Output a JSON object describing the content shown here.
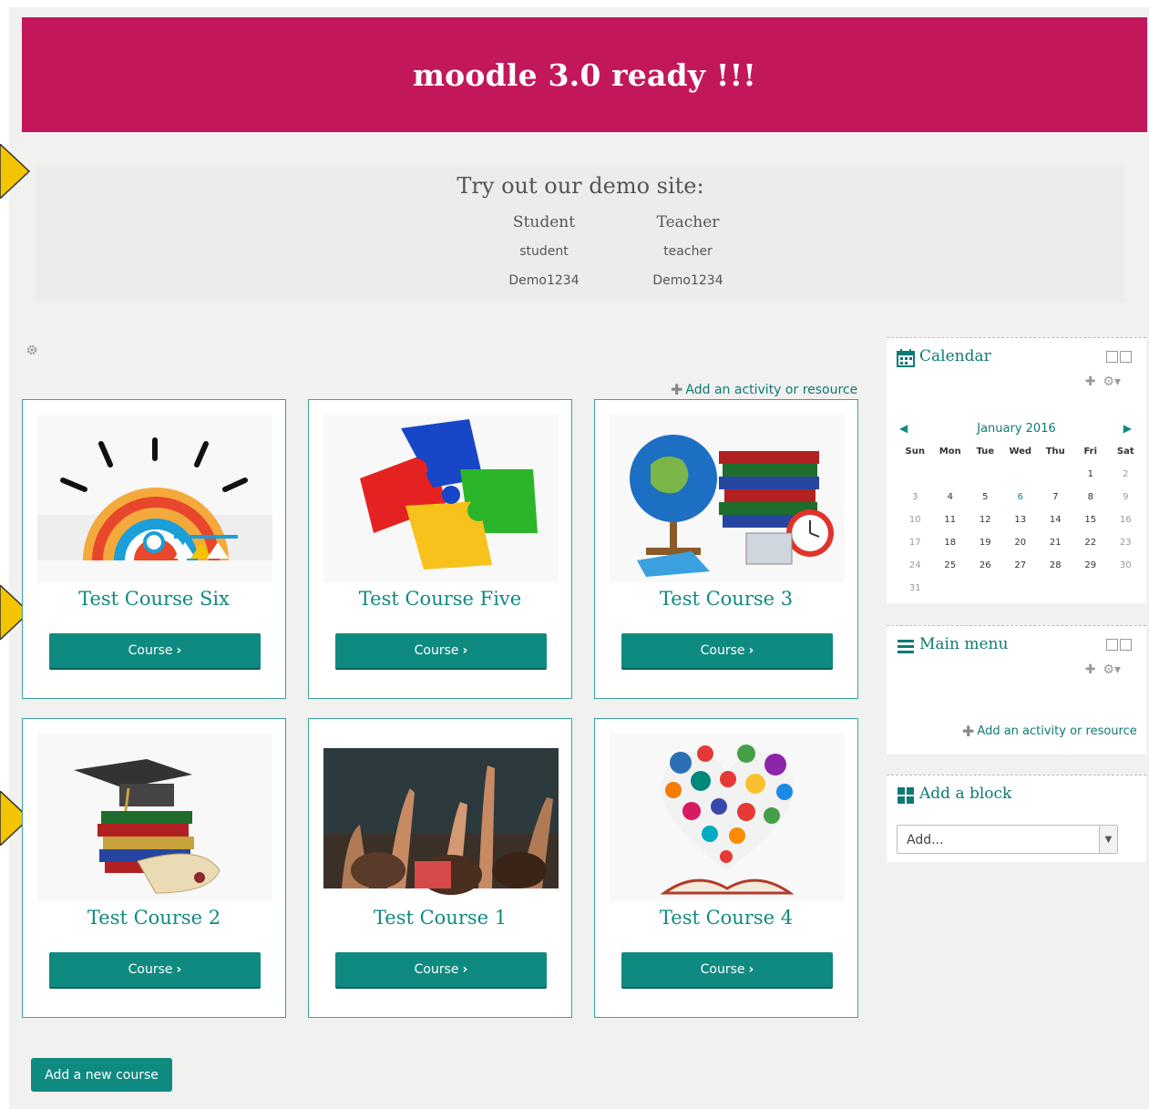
{
  "banner": {
    "title": "moodle 3.0 ready !!!"
  },
  "demo": {
    "title": "Try out our demo site:",
    "columns": [
      {
        "role": "Student",
        "username": "student",
        "password": "Demo1234"
      },
      {
        "role": "Teacher",
        "username": "teacher",
        "password": "Demo1234"
      }
    ]
  },
  "main": {
    "add_activity": "Add an activity or resource",
    "course_button": "Course",
    "courses": [
      {
        "title": "Test Course Six"
      },
      {
        "title": "Test Course Five"
      },
      {
        "title": "Test Course 3"
      },
      {
        "title": "Test Course 2"
      },
      {
        "title": "Test Course 1"
      },
      {
        "title": "Test Course 4"
      }
    ],
    "add_course": "Add a new course"
  },
  "calendar": {
    "title": "Calendar",
    "month": "January 2016",
    "weekdays": [
      "Sun",
      "Mon",
      "Tue",
      "Wed",
      "Thu",
      "Fri",
      "Sat"
    ],
    "weeks": [
      [
        "",
        "",
        "",
        "",
        "",
        "1",
        "2"
      ],
      [
        "3",
        "4",
        "5",
        "6",
        "7",
        "8",
        "9"
      ],
      [
        "10",
        "11",
        "12",
        "13",
        "14",
        "15",
        "16"
      ],
      [
        "17",
        "18",
        "19",
        "20",
        "21",
        "22",
        "23"
      ],
      [
        "24",
        "25",
        "26",
        "27",
        "28",
        "29",
        "30"
      ],
      [
        "31",
        "",
        "",
        "",
        "",
        "",
        ""
      ]
    ],
    "today": "6"
  },
  "main_menu": {
    "title": "Main menu",
    "add_activity": "Add an activity or resource"
  },
  "add_block": {
    "title": "Add a block",
    "select_value": "Add..."
  },
  "colors": {
    "banner": "#c2185b",
    "accent": "#0f8a80"
  }
}
